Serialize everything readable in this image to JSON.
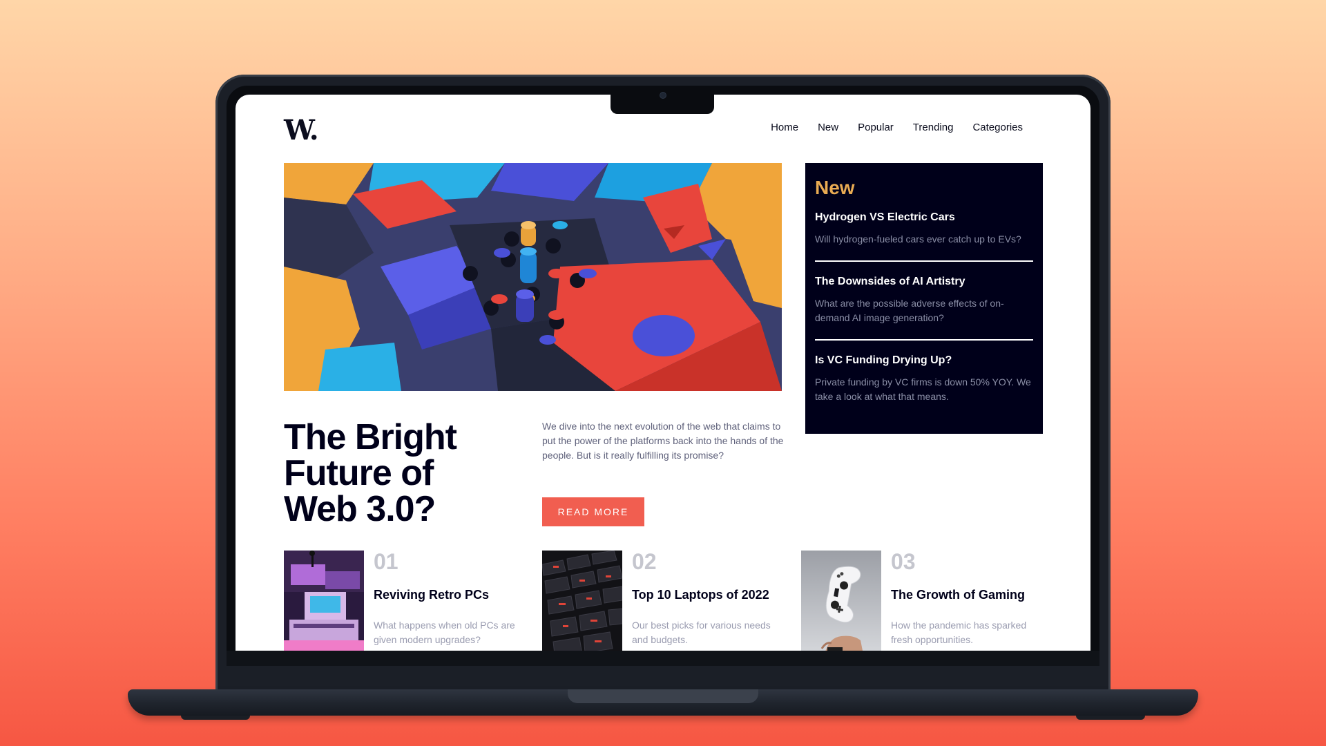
{
  "site": {
    "logo": "W.",
    "nav": [
      "Home",
      "New",
      "Popular",
      "Trending",
      "Categories"
    ]
  },
  "hero": {
    "image": "abstract-3d-blocks-illustration",
    "headline": "The Bright Future of Web 3.0?",
    "lead": "We dive into the next evolution of the web that claims to put the power of the platforms back into the hands of the people. But is it really fulfilling its promise?",
    "button": "READ MORE"
  },
  "new_panel": {
    "title": "New",
    "items": [
      {
        "title": "Hydrogen VS Electric Cars",
        "desc": "Will hydrogen-fueled cars ever catch up to EVs?"
      },
      {
        "title": "The Downsides of AI Artistry",
        "desc": "What are the possible adverse effects of on-demand AI image generation?"
      },
      {
        "title": "Is VC Funding Drying Up?",
        "desc": "Private funding by VC firms is down 50% YOY. We take a look at what that means."
      }
    ]
  },
  "cards": [
    {
      "num": "01",
      "title": "Reviving Retro PCs",
      "desc": "What happens when old PCs are given modern upgrades?",
      "image": "retro-pc-photo"
    },
    {
      "num": "02",
      "title": "Top 10 Laptops of 2022",
      "desc": "Our best picks for various needs and budgets.",
      "image": "keyboard-photo"
    },
    {
      "num": "03",
      "title": "The Growth of Gaming",
      "desc": "How the pandemic has sparked fresh opportunities.",
      "image": "gamepad-photo"
    }
  ],
  "colors": {
    "accent": "#f15e50",
    "panel_bg": "#00001a",
    "panel_title": "#e9ab53",
    "text_dark": "#00001a"
  }
}
